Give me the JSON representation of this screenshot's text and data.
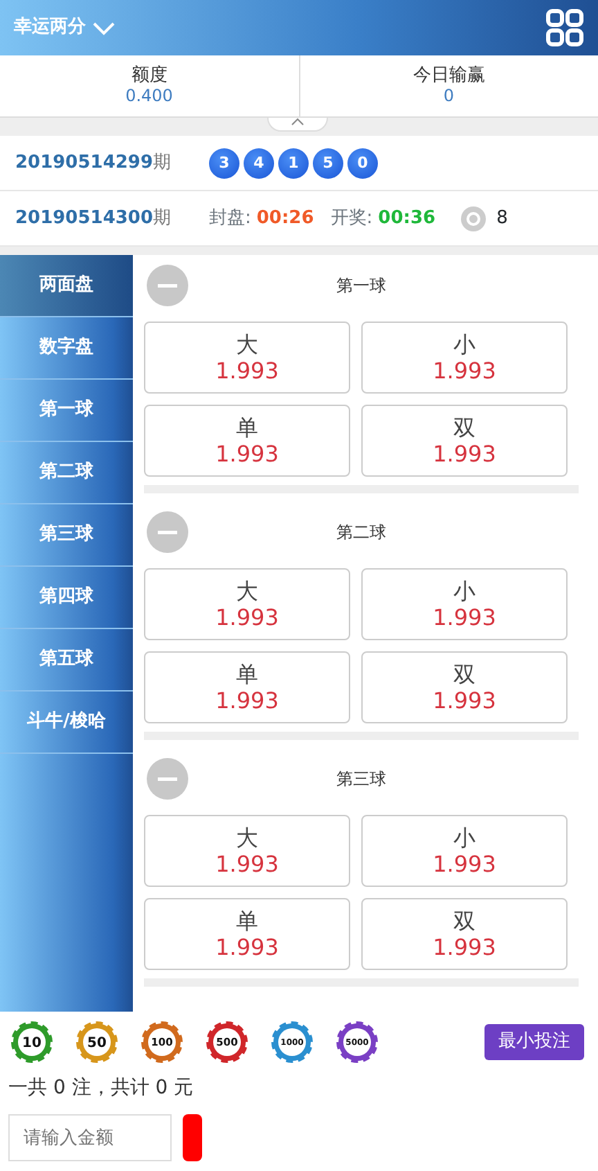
{
  "header": {
    "title": "幸运两分"
  },
  "stats": [
    {
      "label": "额度",
      "value": "0.400"
    },
    {
      "label": "今日输赢",
      "value": "0"
    }
  ],
  "draws": [
    {
      "period": "20190514299",
      "suffix": "期",
      "kind": "result",
      "balls": [
        "3",
        "4",
        "1",
        "5",
        "0"
      ]
    },
    {
      "period": "20190514300",
      "suffix": "期",
      "kind": "timer",
      "close_label": "封盘:",
      "close_time": "00:26",
      "open_label": "开奖:",
      "open_time": "00:36",
      "count": "8"
    }
  ],
  "sidebar": {
    "items": [
      {
        "label": "两面盘",
        "selected": true
      },
      {
        "label": "数字盘",
        "selected": false
      },
      {
        "label": "第一球",
        "selected": false
      },
      {
        "label": "第二球",
        "selected": false
      },
      {
        "label": "第三球",
        "selected": false
      },
      {
        "label": "第四球",
        "selected": false
      },
      {
        "label": "第五球",
        "selected": false
      },
      {
        "label": "斗牛/梭哈",
        "selected": false
      }
    ]
  },
  "sections": [
    {
      "title": "第一球",
      "options": [
        {
          "label": "大",
          "odds": "1.993"
        },
        {
          "label": "小",
          "odds": "1.993"
        },
        {
          "label": "单",
          "odds": "1.993"
        },
        {
          "label": "双",
          "odds": "1.993"
        }
      ]
    },
    {
      "title": "第二球",
      "options": [
        {
          "label": "大",
          "odds": "1.993"
        },
        {
          "label": "小",
          "odds": "1.993"
        },
        {
          "label": "单",
          "odds": "1.993"
        },
        {
          "label": "双",
          "odds": "1.993"
        }
      ]
    },
    {
      "title": "第三球",
      "options": [
        {
          "label": "大",
          "odds": "1.993"
        },
        {
          "label": "小",
          "odds": "1.993"
        },
        {
          "label": "单",
          "odds": "1.993"
        },
        {
          "label": "双",
          "odds": "1.993"
        }
      ]
    }
  ],
  "footer": {
    "chips": [
      {
        "label": "10",
        "color": "#2e9b2a"
      },
      {
        "label": "50",
        "color": "#d7961b"
      },
      {
        "label": "100",
        "color": "#d16a1d"
      },
      {
        "label": "500",
        "color": "#d0262a"
      },
      {
        "label": "1000",
        "color": "#2a8fd0"
      },
      {
        "label": "5000",
        "color": "#7a3fc4"
      }
    ],
    "min_bet_button": "最小投注",
    "summary": "一共 0 注，共计 0 元",
    "amount": {
      "placeholder": "请输入金额"
    }
  }
}
